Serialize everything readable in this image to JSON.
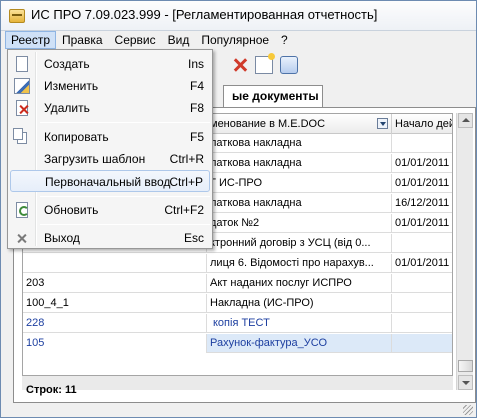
{
  "window": {
    "title": "ИС ПРО 7.09.023.999 - [Регламентированная отчетность]"
  },
  "menubar": {
    "items": [
      "Реестр",
      "Правка",
      "Сервис",
      "Вид",
      "Популярное",
      "?"
    ]
  },
  "tab": {
    "label": "ые документы"
  },
  "grid": {
    "columns": [
      "",
      "менование в M.E.DOC",
      "Начало дей"
    ],
    "rows": [
      [
        "",
        "латкова накладна",
        ""
      ],
      [
        "",
        "латкова накладна",
        "01/01/2011"
      ],
      [
        "",
        "Г ИС-ПРО",
        "01/01/2011"
      ],
      [
        "",
        "латкова накладна",
        "16/12/2011"
      ],
      [
        "",
        "даток №2",
        "01/01/2011"
      ],
      [
        "",
        "ктронний договір з УСЦ (від 0...",
        ""
      ],
      [
        "",
        "лиця 6. Відомості про нарахув...",
        "01/01/2011"
      ],
      [
        "203",
        "Акт наданих послуг ИСПРО",
        ""
      ],
      [
        "100_4_1",
        "Накладна (ИС-ПРО)",
        ""
      ],
      [
        "228",
        "копія ТЕСТ",
        ""
      ],
      [
        "105",
        "Рахунок-фактура_УСО",
        ""
      ]
    ],
    "footer": "Строк: 11"
  },
  "menu": {
    "items": [
      {
        "label": "Создать",
        "shortcut": "Ins",
        "icon": "new-document-icon"
      },
      {
        "label": "Изменить",
        "shortcut": "F4",
        "icon": "edit-icon"
      },
      {
        "label": "Удалить",
        "shortcut": "F8",
        "icon": "delete-icon"
      },
      {
        "label": "Копировать",
        "shortcut": "F5",
        "icon": "copy-icon"
      },
      {
        "label": "Загрузить шаблон",
        "shortcut": "Ctrl+R",
        "icon": ""
      },
      {
        "label": "Первоначальный ввод",
        "shortcut": "Ctrl+P",
        "icon": ""
      },
      {
        "label": "Обновить",
        "shortcut": "Ctrl+F2",
        "icon": "refresh-icon"
      },
      {
        "label": "Выход",
        "shortcut": "Esc",
        "icon": "exit-icon"
      }
    ]
  },
  "colors": {
    "accent": "#cfe1f7",
    "selected_row": "#dce9f8",
    "link_blue": "#1d3fa0",
    "delete_red": "#d03a2a"
  }
}
